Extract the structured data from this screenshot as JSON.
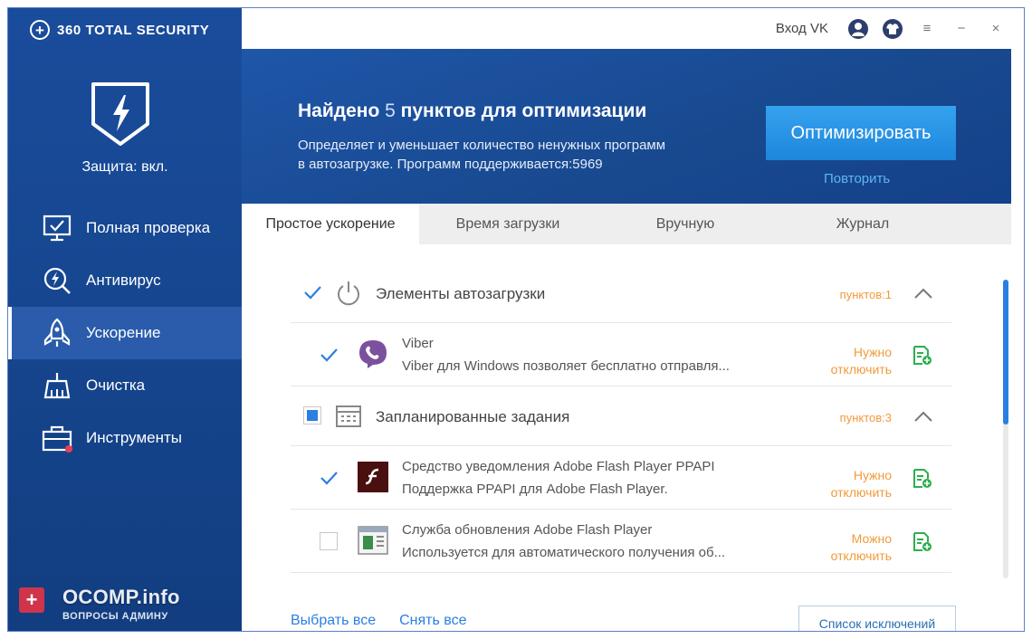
{
  "app": {
    "brand": "360 TOTAL SECURITY",
    "protection_status": "Защита: вкл."
  },
  "sidebar": {
    "items": [
      {
        "label": "Полная проверка",
        "icon": "monitor-check-icon"
      },
      {
        "label": "Антивирус",
        "icon": "magnifier-bolt-icon"
      },
      {
        "label": "Ускорение",
        "icon": "rocket-icon",
        "active": true
      },
      {
        "label": "Очистка",
        "icon": "broom-icon"
      },
      {
        "label": "Инструменты",
        "icon": "toolbox-icon"
      }
    ]
  },
  "topbar": {
    "login_label": "Вход VK",
    "icons": [
      "user-icon",
      "shirt-icon",
      "menu-icon",
      "minimize-icon",
      "close-icon"
    ],
    "menu_glyph": "≡",
    "minimize_glyph": "−",
    "close_glyph": "×"
  },
  "banner": {
    "title_prefix": "Найдено",
    "title_count": "5",
    "title_suffix": "пунктов для оптимизации",
    "description": "Определяет и уменьшает количество ненужных программ в автозагрузке. Программ поддерживается:5969",
    "optimize_button": "Оптимизировать",
    "retry_link": "Повторить"
  },
  "tabs": [
    {
      "label": "Простое ускорение",
      "active": true
    },
    {
      "label": "Время загрузки"
    },
    {
      "label": "Вручную"
    },
    {
      "label": "Журнал"
    }
  ],
  "groups": [
    {
      "label": "Элементы автозагрузки",
      "count": "пунктов:1",
      "checkbox": "checked",
      "icon": "power-icon",
      "items": [
        {
          "title": "Viber",
          "description": "Viber для Windows позволяет бесплатно отправля...",
          "status_line1": "Нужно",
          "status_line2": "отключить",
          "checked": true,
          "icon": "viber-icon"
        }
      ]
    },
    {
      "label": "Запланированные задания",
      "count": "пунктов:3",
      "checkbox": "partial",
      "icon": "calendar-icon",
      "items": [
        {
          "title": "Средство уведомления Adobe Flash Player PPAPI",
          "description": "Поддержка PPAPI для Adobe Flash Player.",
          "status_line1": "Нужно",
          "status_line2": "отключить",
          "checked": true,
          "icon": "flash-player-icon"
        },
        {
          "title": "Служба обновления Adobe Flash Player",
          "description": "Используется для автоматического получения об...",
          "status_line1": "Можно",
          "status_line2": "отключить",
          "checked": false,
          "icon": "update-service-icon"
        }
      ]
    }
  ],
  "footer": {
    "select_all": "Выбрать все",
    "deselect_all": "Снять все",
    "exceptions_button": "Список исключений"
  },
  "watermark": {
    "badge": "+",
    "main": "OCOMP.info",
    "sub": "ВОПРОСЫ АДМИНУ"
  },
  "colors": {
    "sidebar": "#16468f",
    "accent": "#2a7fe0",
    "warning": "#f29a3a",
    "action_green": "#2fae4f"
  }
}
